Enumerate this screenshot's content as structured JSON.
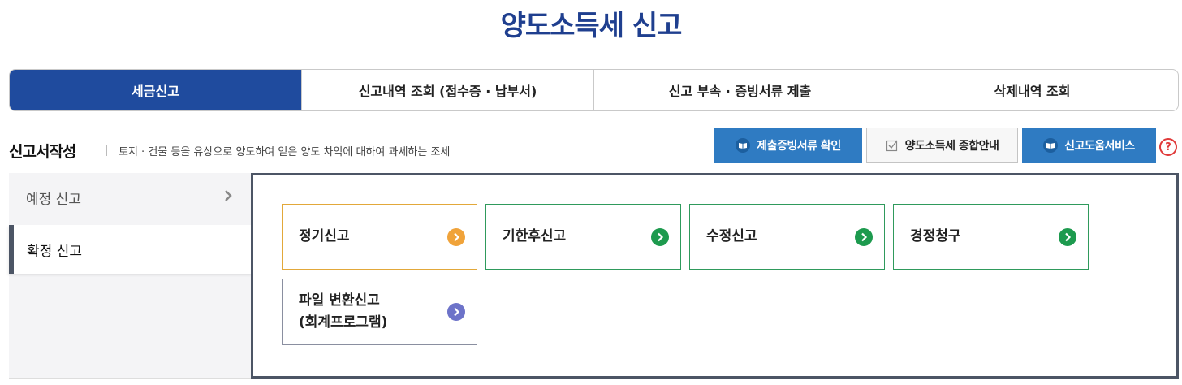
{
  "page": {
    "title": "양도소득세 신고"
  },
  "tabs": [
    {
      "label": "세금신고",
      "active": true
    },
    {
      "label": "신고내역 조회 (접수증 · 납부서)",
      "active": false
    },
    {
      "label": "신고 부속 · 증빙서류 제출",
      "active": false
    },
    {
      "label": "삭제내역 조회",
      "active": false
    }
  ],
  "section": {
    "title": "신고서작성",
    "description": "토지 · 건물 등을 유상으로 양도하여 얻은 양도 차익에 대하여 과세하는 조세"
  },
  "actions": {
    "proof_docs": {
      "label": "제출증빙서류 확인",
      "icon": "book-icon"
    },
    "guide": {
      "label": "양도소득세 종합안내",
      "icon": "checkbox-icon"
    },
    "help_service": {
      "label": "신고도움서비스",
      "icon": "book-icon"
    },
    "help": {
      "label": "?",
      "icon": "question-icon"
    }
  },
  "side_nav": [
    {
      "label": "예정 신고",
      "active": false
    },
    {
      "label": "확정 신고",
      "active": true
    }
  ],
  "cards": [
    {
      "label": "정기신고",
      "border": "#e2a83a",
      "arrow_color": "#f0a33a"
    },
    {
      "label": "기한후신고",
      "border": "#2f9a5c",
      "arrow_color": "#1d9a4e"
    },
    {
      "label": "수정신고",
      "border": "#2f9a5c",
      "arrow_color": "#1d9a4e"
    },
    {
      "label": "경정청구",
      "border": "#2f9a5c",
      "arrow_color": "#1d9a4e"
    },
    {
      "label_line1": "파일 변환신고",
      "label_line2": "(회계프로그램)",
      "border": "#8a8fa0",
      "arrow_color": "#6d73c9"
    }
  ],
  "colors": {
    "brand_blue": "#1f4b9e",
    "button_blue": "#2f7bc2",
    "title_blue": "#1f3f8f"
  }
}
